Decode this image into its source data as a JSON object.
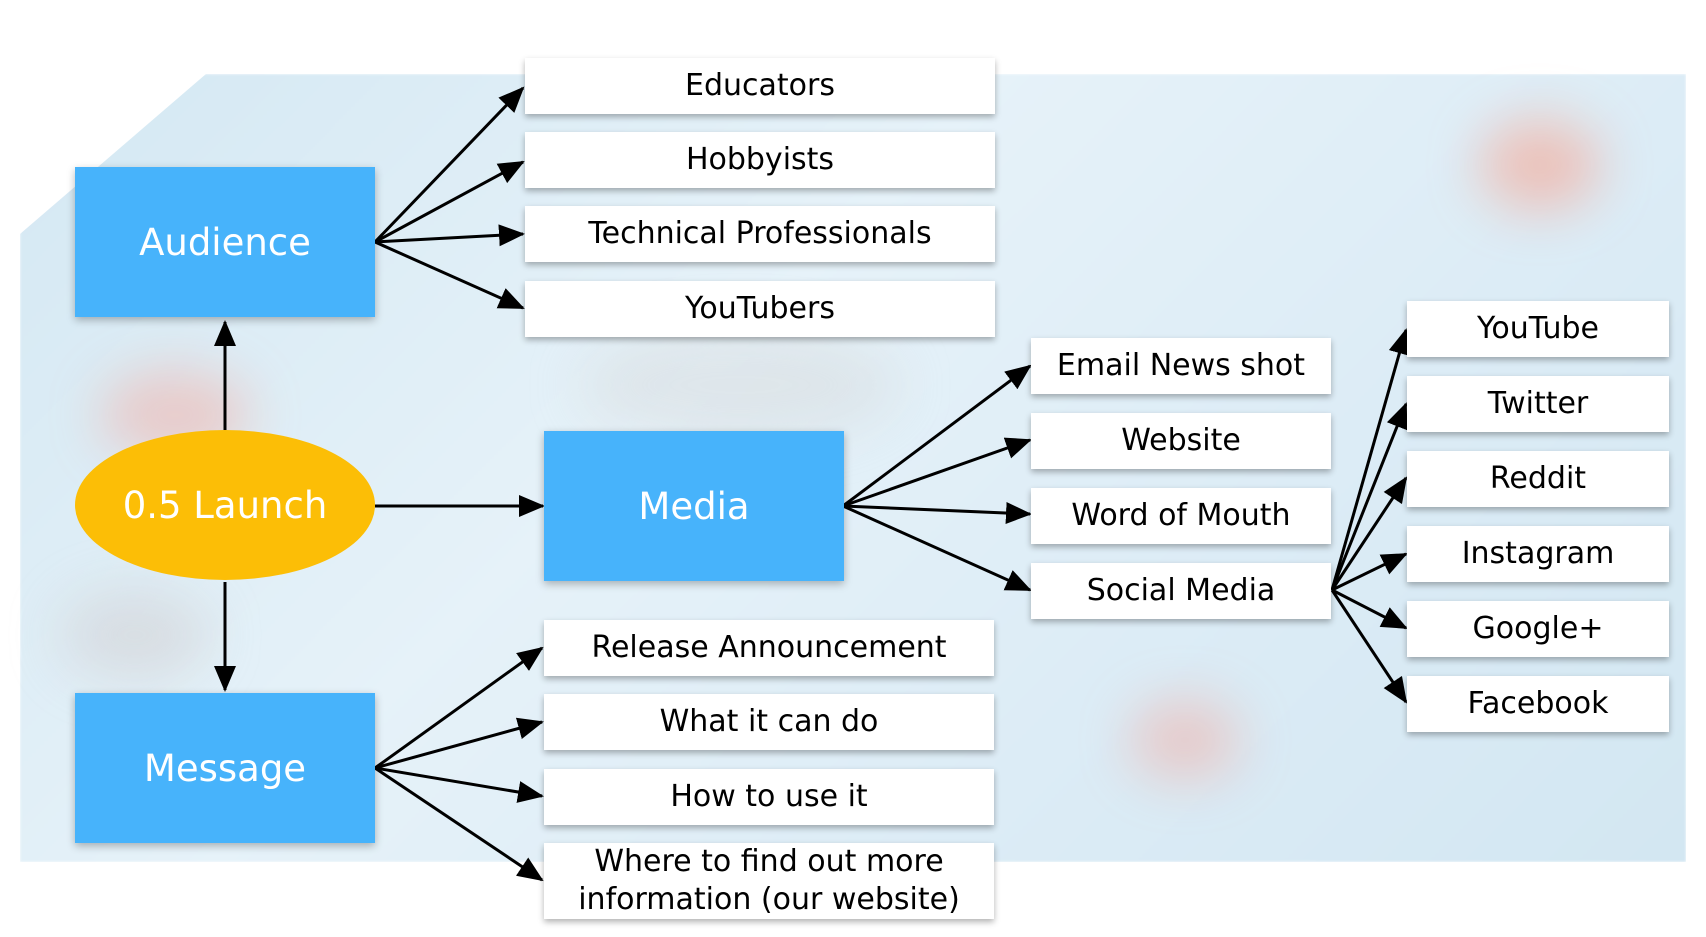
{
  "diagram": {
    "root": "0.5 Launch",
    "hubs": {
      "audience": "Audience",
      "media": "Media",
      "message": "Message"
    },
    "audience_items": [
      "Educators",
      "Hobbyists",
      "Technical Professionals",
      "YouTubers"
    ],
    "media_items": [
      "Email News shot",
      "Website",
      "Word of Mouth",
      "Social Media"
    ],
    "message_items": [
      "Release Announcement",
      "What it can do",
      "How to use it",
      "Where to find out more\ninformation (our website)"
    ],
    "social_items": [
      "YouTube",
      "Twitter",
      "Reddit",
      "Instagram",
      "Google+",
      "Facebook"
    ],
    "colors": {
      "hub": "#47b3fb",
      "root": "#fcbe06",
      "leaf": "#ffffff",
      "arrow": "#000000"
    }
  }
}
